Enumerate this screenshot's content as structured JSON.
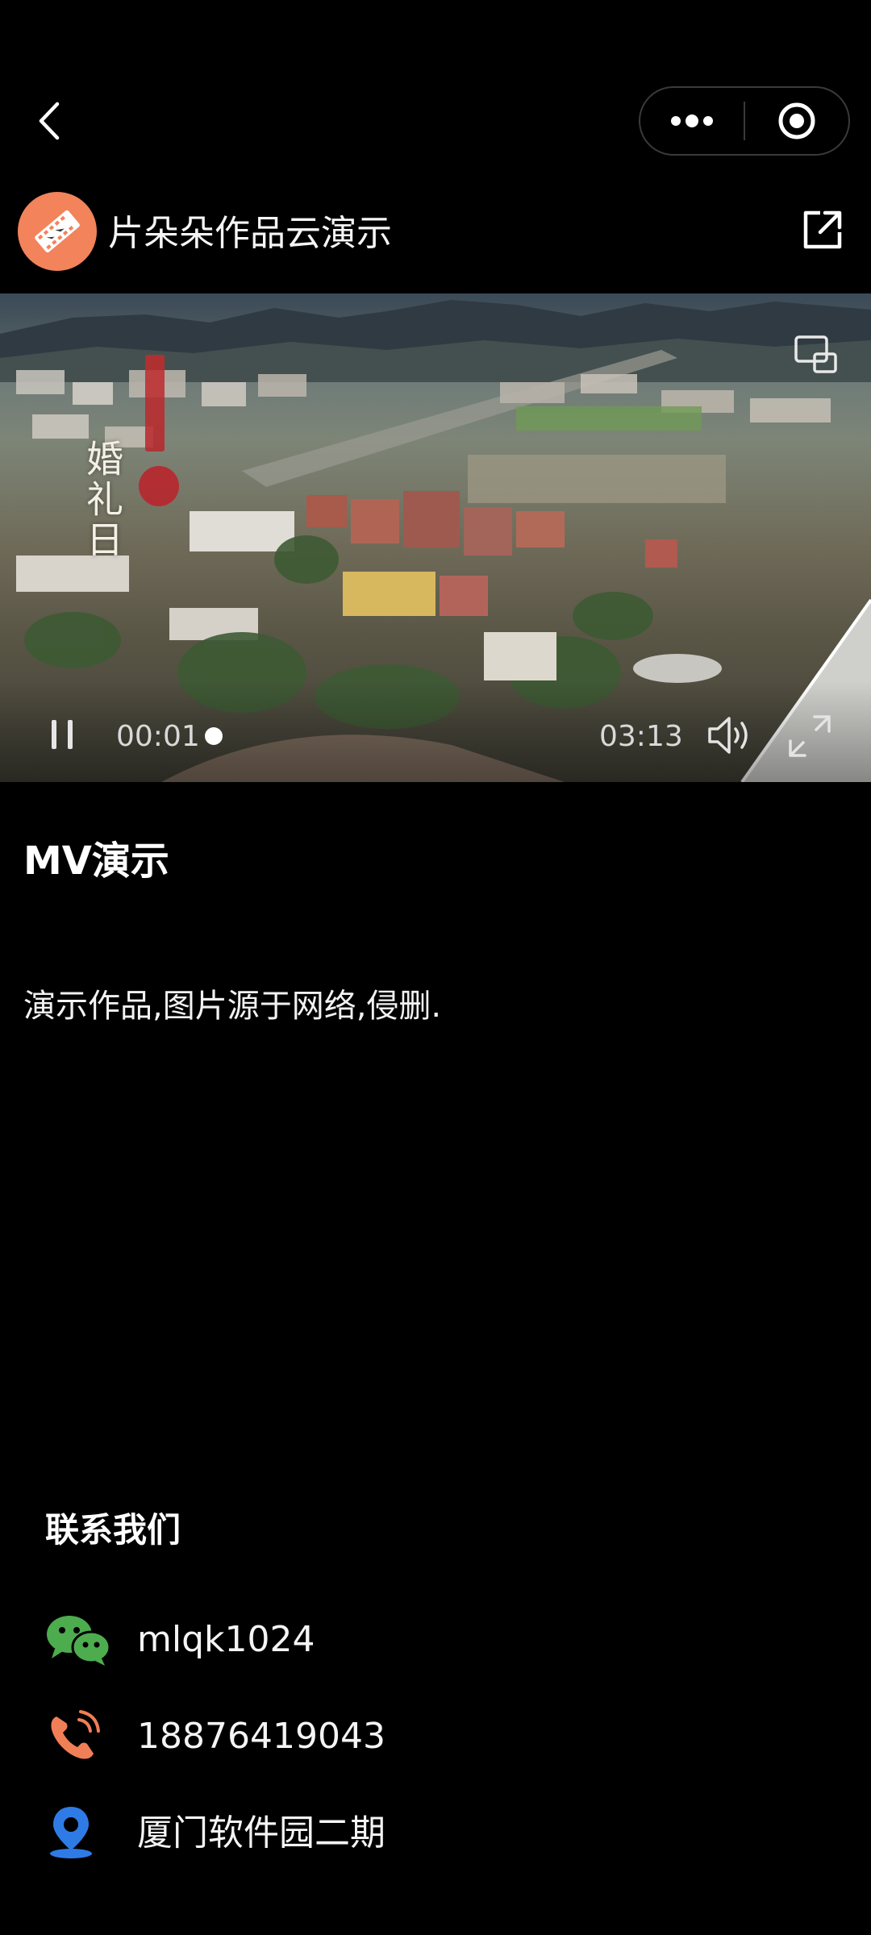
{
  "top_bar": {
    "back_icon": "chevron-left-icon",
    "more_icon": "more-dots-icon",
    "close_icon": "target-circle-icon"
  },
  "header": {
    "title": "片朵朵作品云演示",
    "avatar_icon": "film-strip-icon",
    "avatar_color": "#f2835b",
    "share_icon": "share-external-icon"
  },
  "video": {
    "current_time": "00:01",
    "total_time": "03:13",
    "progress": 0.005,
    "overlay_title": "婚礼日",
    "controls": {
      "play_state": "playing",
      "pause_icon": "pause-icon",
      "mute_icon": "volume-icon",
      "fullscreen_icon": "fullscreen-icon",
      "pip_icon": "picture-in-picture-icon"
    }
  },
  "content": {
    "title": "MV演示",
    "description": "演示作品,图片源于网络,侵删."
  },
  "contact": {
    "heading": "联系我们",
    "items": [
      {
        "icon": "wechat-icon",
        "text": "mlqk1024",
        "color": "#4dac4d"
      },
      {
        "icon": "phone-icon",
        "text": "18876419043",
        "color": "#f07e57"
      },
      {
        "icon": "location-pin-icon",
        "text": "厦门软件园二期",
        "color": "#2f7be6"
      }
    ]
  }
}
